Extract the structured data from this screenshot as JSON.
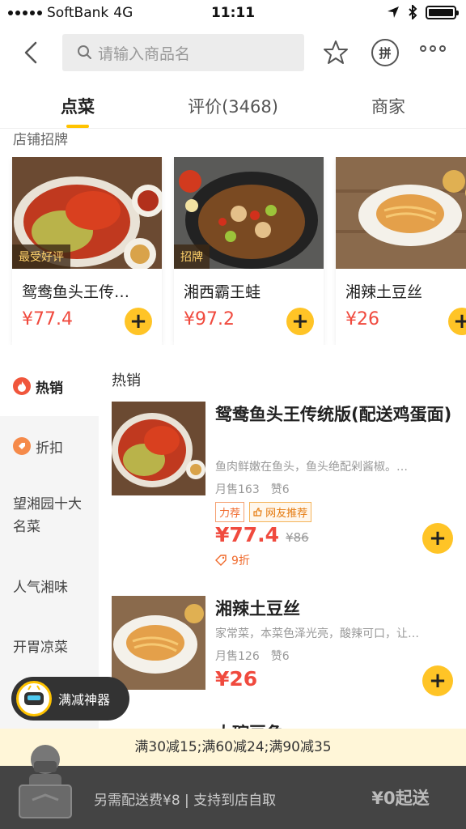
{
  "status_bar": {
    "carrier": "SoftBank",
    "network": "4G",
    "time": "11:11"
  },
  "nav": {
    "search_placeholder": "请输入商品名",
    "pin_label": "拼"
  },
  "tabs": [
    {
      "label": "点菜",
      "active": true
    },
    {
      "label": "评价(3468)",
      "active": false
    },
    {
      "label": "商家",
      "active": false
    }
  ],
  "signature": {
    "title": "店铺招牌",
    "items": [
      {
        "name": "鸳鸯鱼头王传统版(配送鸡蛋面)",
        "name_display": "鸳鸯鱼头王传…",
        "price": "¥77.4",
        "badge": "最受好评"
      },
      {
        "name": "湘西霸王蛙",
        "price": "¥97.2",
        "badge": "招牌"
      },
      {
        "name": "湘辣土豆丝",
        "price": "¥26",
        "badge": ""
      }
    ]
  },
  "categories": [
    {
      "label": "热销",
      "icon": "flame-icon",
      "active": true
    },
    {
      "label": "折扣",
      "icon": "discount-icon",
      "active": false
    },
    {
      "label": "望湘园十大名菜",
      "active": false
    },
    {
      "label": "人气湘味",
      "active": false
    },
    {
      "label": "开胃凉菜",
      "active": false
    }
  ],
  "hot": {
    "title": "热销",
    "items": [
      {
        "name": "鸳鸯鱼头王传统版(配送鸡蛋面)",
        "desc": "鱼肉鲜嫩在鱼头，鱼头绝配剁酱椒。…",
        "monthly_sales": "月售163",
        "likes": "赞6",
        "tags": [
          "力荐",
          "网友推荐"
        ],
        "price": "¥77.4",
        "old_price": "¥86",
        "discount": "9折"
      },
      {
        "name": "湘辣土豆丝",
        "desc": "家常菜，本菜色泽光亮，酸辣可口，让…",
        "monthly_sales": "月售126",
        "likes": "赞6",
        "price": "¥26"
      },
      {
        "name": "大碗豆角"
      }
    ]
  },
  "bot": {
    "label": "满减神器"
  },
  "promo": {
    "text": "满30减15;满60减24;满90减35"
  },
  "bottom": {
    "info": "另需配送费¥8 | 支持到店自取",
    "min_order": "¥0起送"
  },
  "colors": {
    "accent": "#ffc426",
    "price": "#f04a3e",
    "dark_bar": "#444444"
  }
}
